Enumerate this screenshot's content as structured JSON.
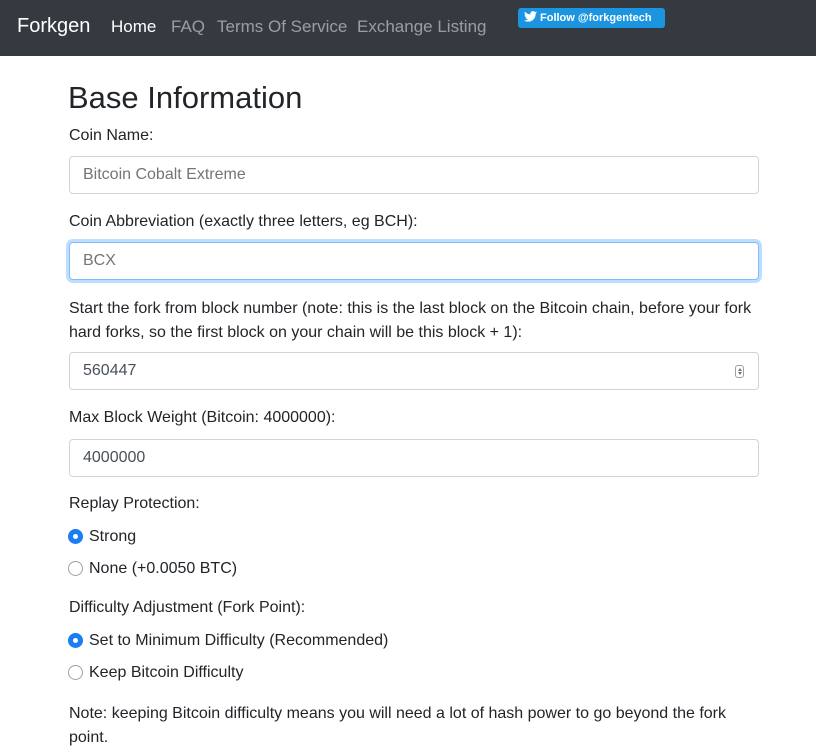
{
  "navbar": {
    "brand": "Forkgen",
    "links": [
      {
        "label": "Home",
        "active": true
      },
      {
        "label": "FAQ",
        "active": false
      },
      {
        "label": "Terms Of Service",
        "active": false
      },
      {
        "label": "Exchange Listing",
        "active": false
      }
    ],
    "twitter_button": {
      "label": "Follow @forkgentech",
      "icon": "twitter-bird-icon",
      "color": "#1b95e0"
    },
    "background": "#343a40"
  },
  "form": {
    "title": "Base Information",
    "coin_name": {
      "label": "Coin Name:",
      "value": "",
      "placeholder": "Bitcoin Cobalt Extreme"
    },
    "coin_abbreviation": {
      "label": "Coin Abbreviation (exactly three letters, eg BCH):",
      "value": "",
      "placeholder": "BCX"
    },
    "fork_block": {
      "label": "Start the fork from block number (note: this is the last block on the Bitcoin chain, before your fork hard forks, so the first block on your chain will be this block + 1):",
      "value": "560447"
    },
    "max_block_weight": {
      "label": "Max Block Weight (Bitcoin: 4000000):",
      "value": "4000000"
    },
    "replay_protection": {
      "label": "Replay Protection:",
      "options": [
        {
          "label": "Strong",
          "checked": true
        },
        {
          "label": "None (+0.0050 BTC)",
          "checked": false
        }
      ]
    },
    "difficulty_adjustment": {
      "label": "Difficulty Adjustment (Fork Point):",
      "options": [
        {
          "label": "Set to Minimum Difficulty (Recommended)",
          "checked": true
        },
        {
          "label": "Keep Bitcoin Difficulty",
          "checked": false
        }
      ]
    },
    "note": "Note: keeping Bitcoin difficulty means you will need a lot of hash power to go beyond the fork point."
  },
  "colors": {
    "accent": "#1a7ef2",
    "focus_border": "#80bdff"
  }
}
